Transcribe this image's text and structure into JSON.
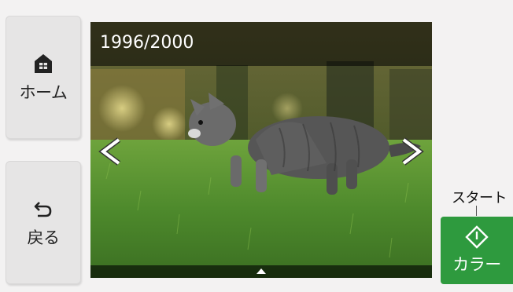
{
  "sidebar": {
    "home_label": "ホーム",
    "back_label": "戻る"
  },
  "preview": {
    "counter": "1996/2000"
  },
  "start": {
    "caption": "スタート",
    "button_label": "カラー"
  },
  "icons": {
    "home": "home-icon",
    "back": "back-arrow-icon",
    "prev": "chevron-left-icon",
    "next": "chevron-right-icon",
    "start": "start-diamond-icon",
    "details": "triangle-up-icon"
  },
  "colors": {
    "start_button": "#2e9a3e",
    "panel_background": "#f3f2f2",
    "side_button": "#e6e5e5"
  }
}
